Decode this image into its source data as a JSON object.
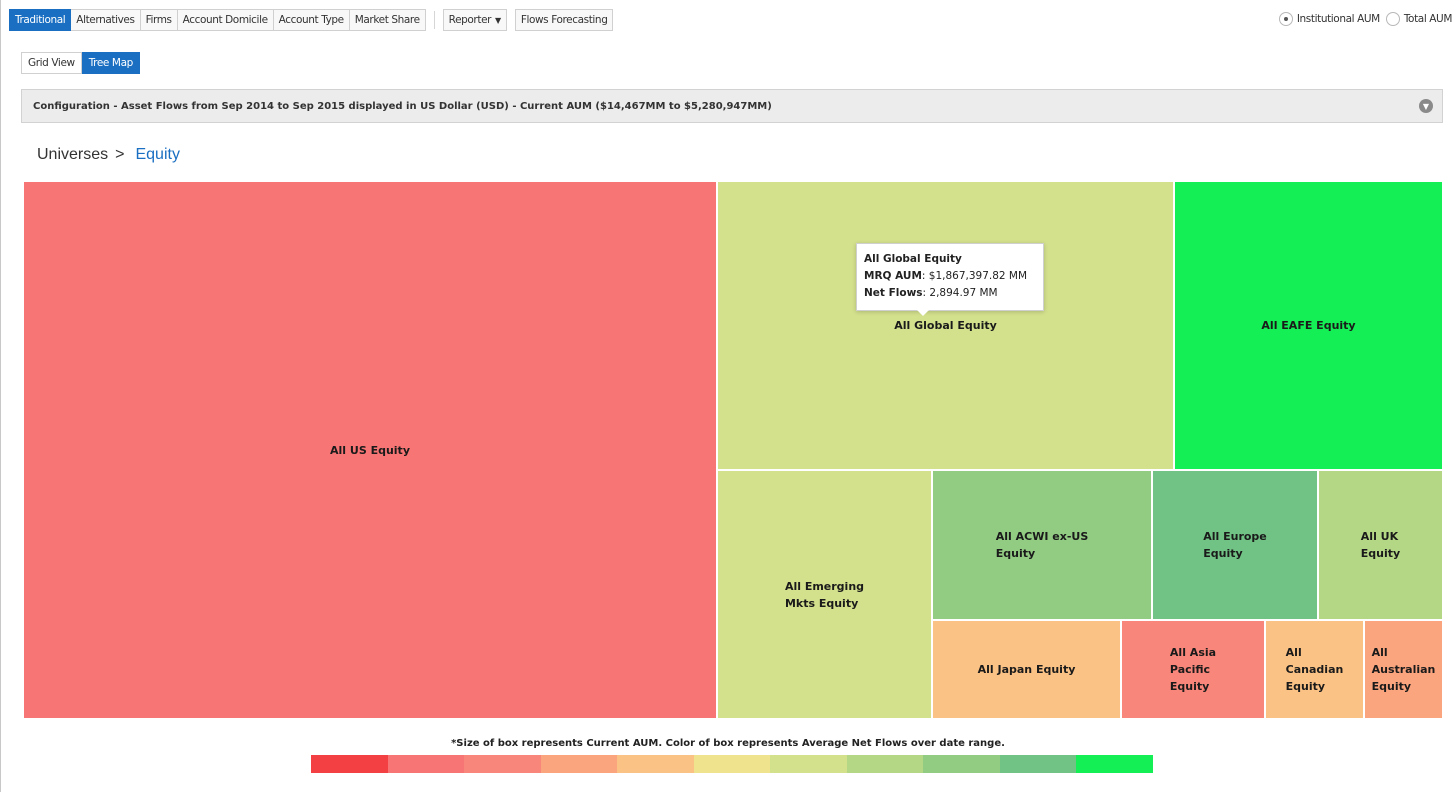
{
  "nav": {
    "tabs": [
      {
        "label": "Traditional",
        "active": true
      },
      {
        "label": "Alternatives"
      },
      {
        "label": "Firms"
      },
      {
        "label": "Account Domicile"
      },
      {
        "label": "Account Type"
      },
      {
        "label": "Market Share"
      }
    ],
    "reporter_label": "Reporter",
    "flows_forecasting_label": "Flows Forecasting"
  },
  "aum_toggle": {
    "institutional_label": "Institutional AUM",
    "total_label": "Total AUM",
    "selected": "Institutional AUM"
  },
  "view_toggle": {
    "grid_label": "Grid View",
    "treemap_label": "Tree Map",
    "active": "Tree Map"
  },
  "config": {
    "text": "Configuration - Asset Flows from Sep 2014 to Sep 2015 displayed in US Dollar (USD) - Current AUM ($14,467MM to $5,280,947MM)"
  },
  "breadcrumb": {
    "root": "Universes",
    "separator": ">",
    "current": "Equity"
  },
  "treemap": {
    "cells": [
      {
        "label": "All US Equity",
        "color": "#f87575"
      },
      {
        "label": "All Global Equity",
        "color": "#d3e08c"
      },
      {
        "label": "All EAFE Equity",
        "color": "#13ef55"
      },
      {
        "label": "All Emerging Mkts Equity",
        "line1": "All Emerging",
        "line2": "Mkts Equity",
        "color": "#d3e08c"
      },
      {
        "label": "All ACWI ex-US Equity",
        "line1": "All ACWI ex-US",
        "line2": "Equity",
        "color": "#92cc83"
      },
      {
        "label": "All Europe Equity",
        "line1": "All Europe",
        "line2": "Equity",
        "color": "#71c385"
      },
      {
        "label": "All UK Equity",
        "line1": "All UK",
        "line2": "Equity",
        "color": "#b4d786"
      },
      {
        "label": "All Japan Equity",
        "color": "#fbc285"
      },
      {
        "label": "All Asia Pacific Equity",
        "line1": "All Asia",
        "line2": "Pacific",
        "line3": "Equity",
        "color": "#f8867a"
      },
      {
        "label": "All Canadian Equity",
        "line1": "All",
        "line2": "Canadian",
        "line3": "Equity",
        "color": "#fbc285"
      },
      {
        "label": "All Australian Equity",
        "line1": "All",
        "line2": "Australian",
        "line3": "Equity",
        "color": "#fba57f"
      }
    ],
    "tooltip": {
      "title": "All Global Equity",
      "aum_label": "MRQ AUM",
      "aum_value": ": $1,867,397.82 MM",
      "flows_label": "Net Flows",
      "flows_value": ": 2,894.97 MM"
    }
  },
  "legend": {
    "note": "*Size of box represents Current AUM. Color of box represents Average Net Flows over date range.",
    "scale_colors": [
      "#f34143",
      "#f87575",
      "#f8867a",
      "#fba57f",
      "#fbc285",
      "#f0e38e",
      "#d3e08c",
      "#b4d786",
      "#92cc83",
      "#71c385",
      "#13ef55"
    ]
  }
}
